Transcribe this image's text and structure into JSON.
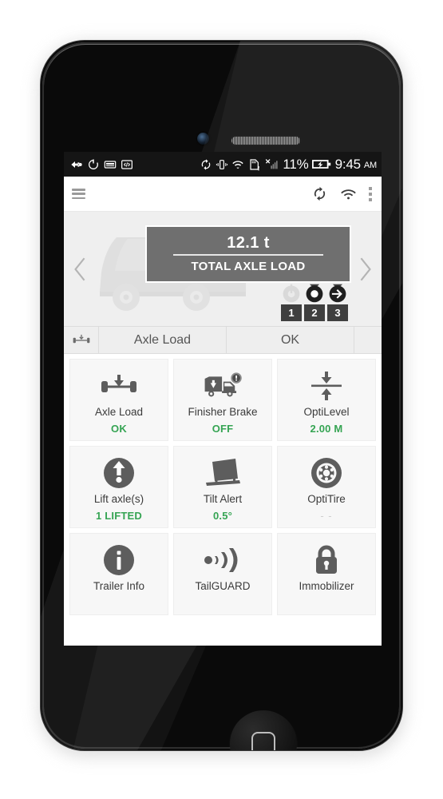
{
  "device": {
    "kind": "smartphone-mockup"
  },
  "statusbar": {
    "left_icons": [
      "usb-debug-icon",
      "sync-power-icon",
      "keyboard-icon",
      "developer-code-icon"
    ],
    "right_icons": [
      "sync-icon",
      "vibrate-icon",
      "wifi-transfer-icon",
      "sd-card-warning-icon",
      "no-signal-icon",
      "signal-bars-icon"
    ],
    "battery_percent": "11%",
    "battery_icon": "battery-charging-icon",
    "time": "9:45",
    "meridiem": "AM"
  },
  "appbar": {
    "menu_icon": "hamburger-menu-icon",
    "actions": [
      {
        "icon": "sync-refresh-icon",
        "name": "sync-button"
      },
      {
        "icon": "wifi-icon",
        "name": "wifi-button"
      },
      {
        "icon": "overflow-menu-icon",
        "name": "overflow-menu-button"
      }
    ]
  },
  "hero": {
    "prev_icon": "chevron-left-icon",
    "next_icon": "chevron-right-icon",
    "vehicle_icon": "truck-silhouette-icon",
    "value": "12.1 t",
    "label": "TOTAL AXLE LOAD",
    "axles": [
      {
        "number": "1",
        "state": "inactive",
        "icon": "axle-lifted-icon"
      },
      {
        "number": "2",
        "state": "active",
        "icon": "axle-wheel-icon"
      },
      {
        "number": "3",
        "state": "active",
        "icon": "axle-steer-arrow-icon"
      }
    ]
  },
  "summary_strip": {
    "icon": "axle-load-icon",
    "name": "Axle Load",
    "state": "OK"
  },
  "tiles": [
    {
      "icon": "axle-load-icon",
      "name": "Axle Load",
      "value": "OK",
      "value_style": "ok"
    },
    {
      "icon": "finisher-brake-icon",
      "name": "Finisher Brake",
      "value": "OFF",
      "value_style": "ok"
    },
    {
      "icon": "optilevel-icon",
      "name": "OptiLevel",
      "value": "2.00 M",
      "value_style": "ok"
    },
    {
      "icon": "lift-axle-icon",
      "name": "Lift axle(s)",
      "value": "1 LIFTED",
      "value_style": "ok"
    },
    {
      "icon": "tilt-alert-icon",
      "name": "Tilt Alert",
      "value": "0.5°",
      "value_style": "ok"
    },
    {
      "icon": "optitire-icon",
      "name": "OptiTire",
      "value": "- -",
      "value_style": "muted"
    },
    {
      "icon": "trailer-info-icon",
      "name": "Trailer Info",
      "value": "",
      "value_style": "none"
    },
    {
      "icon": "tailguard-icon",
      "name": "TailGUARD",
      "value": "",
      "value_style": "none"
    },
    {
      "icon": "immobilizer-icon",
      "name": "Immobilizer",
      "value": "",
      "value_style": "none"
    }
  ],
  "colors": {
    "accent_green": "#35a453",
    "hero_bg": "#efefef",
    "loadbox_bg": "#6f6f6f",
    "icon_gray": "#5d5d5d",
    "statusbar_bg": "#151515"
  }
}
